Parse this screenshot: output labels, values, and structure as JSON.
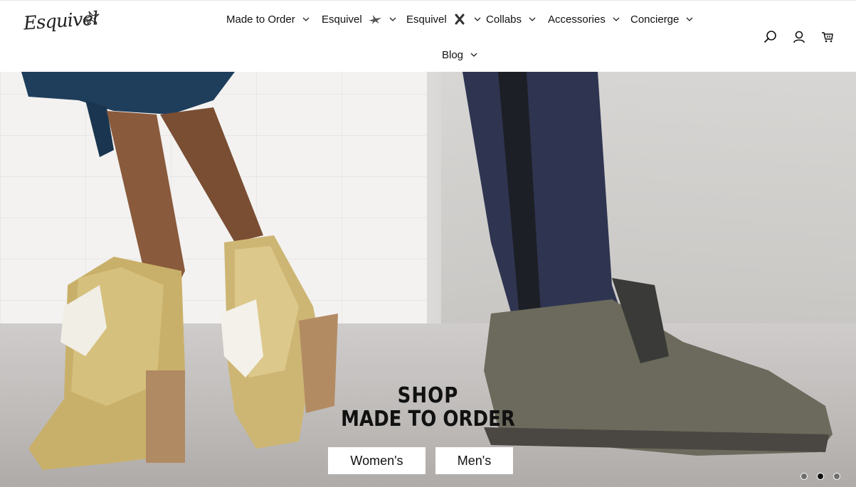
{
  "header": {
    "logo_alt": "Esquivel",
    "nav_row1": [
      {
        "label": "Made to Order",
        "glyph": null
      },
      {
        "label": "Esquivel",
        "glyph": "bird-icon"
      },
      {
        "label": "Esquivel",
        "glyph": "crossed-bones-icon"
      },
      {
        "label": "Collabs",
        "glyph": null
      },
      {
        "label": "Accessories",
        "glyph": null
      },
      {
        "label": "Concierge",
        "glyph": null
      }
    ],
    "nav_row2": [
      {
        "label": "Blog",
        "glyph": null
      }
    ],
    "icons": [
      "search-icon",
      "account-icon",
      "cart-icon"
    ]
  },
  "hero": {
    "line1": "SHOP",
    "line2": "MADE TO ORDER",
    "buttons": {
      "women": "Women's",
      "men": "Men's"
    },
    "slides": {
      "count": 3,
      "active_index": 1
    }
  },
  "colors": {
    "text": "#111111",
    "background": "#ffffff",
    "dot_inactive": "#6e6e6e",
    "dot_active": "#111111"
  }
}
